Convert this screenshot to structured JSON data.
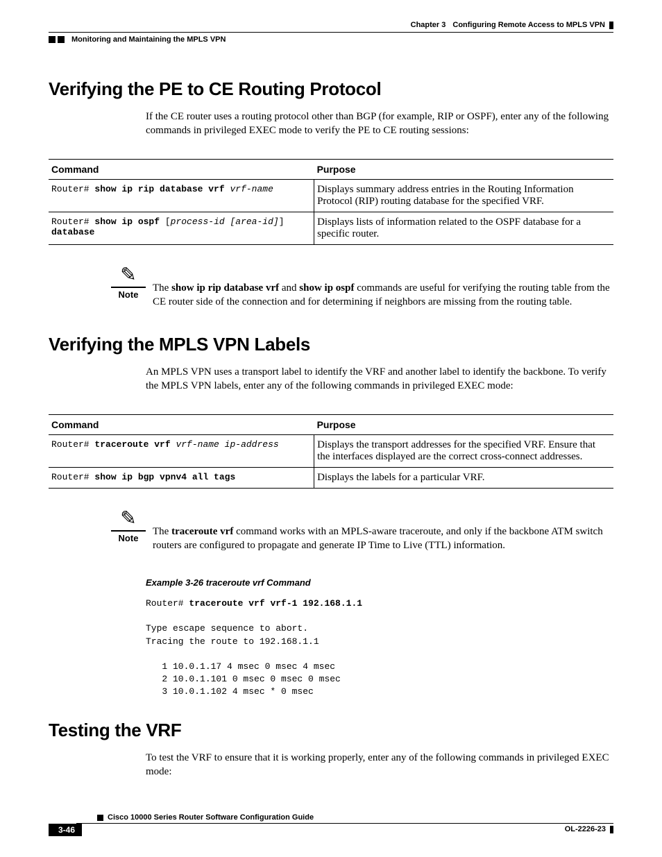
{
  "header": {
    "chapter_label": "Chapter 3",
    "chapter_title": "Configuring Remote Access to MPLS VPN",
    "section_crumb": "Monitoring and Maintaining the MPLS VPN"
  },
  "sec1": {
    "title": "Verifying the PE to CE Routing Protocol",
    "intro": "If the CE router uses a routing protocol other than BGP (for example, RIP or OSPF), enter any of the following commands in privileged EXEC mode to verify the PE to CE routing sessions:",
    "th_command": "Command",
    "th_purpose": "Purpose",
    "row1": {
      "prompt": "Router# ",
      "bold": "show ip rip database vrf ",
      "italic": "vrf-name",
      "purpose": "Displays summary address entries in the Routing Information Protocol (RIP) routing database for the specified VRF."
    },
    "row2": {
      "prompt": "Router# ",
      "bold": "show ip ospf ",
      "bracket_open": "[",
      "italic": "process-id [area-id]",
      "bracket_close": "] ",
      "bold2": "database",
      "purpose": "Displays lists of information related to the OSPF database for a specific router."
    },
    "note_label": "Note",
    "note_pre": "The ",
    "note_kw1": "show ip rip database vrf",
    "note_mid": " and ",
    "note_kw2": "show ip ospf",
    "note_post": " commands are useful for verifying the routing table from the CE router side of the connection and for determining if neighbors are missing from the routing table."
  },
  "sec2": {
    "title": "Verifying the MPLS VPN Labels",
    "intro": "An MPLS VPN uses a transport label to identify the VRF and another label to identify the backbone. To verify the MPLS VPN labels, enter any of the following commands in privileged EXEC mode:",
    "th_command": "Command",
    "th_purpose": "Purpose",
    "row1": {
      "prompt": "Router# ",
      "bold": "traceroute vrf ",
      "italic": "vrf-name ip-address",
      "purpose": "Displays the transport addresses for the specified VRF. Ensure that the interfaces displayed are the correct cross-connect addresses."
    },
    "row2": {
      "prompt": "Router# ",
      "bold": "show ip bgp vpnv4 all tags",
      "purpose": "Displays the labels for a particular VRF."
    },
    "note_label": "Note",
    "note_pre": "The ",
    "note_kw1": "traceroute vrf",
    "note_post": " command works with an MPLS-aware traceroute, and only if the backbone ATM switch routers are configured to propagate and generate IP Time to Live (TTL) information."
  },
  "example": {
    "title": "Example 3-26   traceroute vrf Command",
    "prompt": "Router# ",
    "cmd_bold": "traceroute vrf vrf-1 192.168.1.1",
    "line_blank": "",
    "line1": "Type escape sequence to abort.",
    "line2": "Tracing the route to 192.168.1.1",
    "line3": "   1 10.0.1.17 4 msec 0 msec 4 msec",
    "line4": "   2 10.0.1.101 0 msec 0 msec 0 msec",
    "line5": "   3 10.0.1.102 4 msec * 0 msec"
  },
  "sec3": {
    "title": "Testing the VRF",
    "intro": "To test the VRF to ensure that it is working properly, enter any of the following commands in privileged EXEC mode:"
  },
  "footer": {
    "guide_title": "Cisco 10000 Series Router Software Configuration Guide",
    "page_num": "3-46",
    "doc_id": "OL-2226-23"
  }
}
